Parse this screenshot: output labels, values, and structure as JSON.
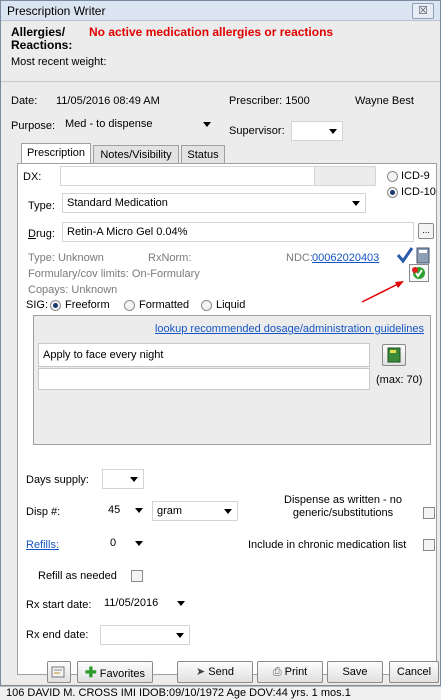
{
  "window": {
    "title": "Prescription Writer",
    "close_glyph": "☒"
  },
  "allergies": {
    "label_line1": "Allergies/",
    "label_line2": "Reactions:",
    "status": "No active medication allergies or reactions",
    "weight_label": "Most recent weight:"
  },
  "header": {
    "date_label": "Date:",
    "date_value": "11/05/2016 08:49 AM",
    "prescriber_label": "Prescriber: 1500",
    "prescriber_name": "Wayne Best",
    "purpose_label": "Purpose:",
    "purpose_value": "Med - to dispense",
    "supervisor_label": "Supervisor:",
    "supervisor_value": ""
  },
  "tabs": [
    {
      "label": "Prescription",
      "active": true
    },
    {
      "label": "Notes/Visibility",
      "active": false
    },
    {
      "label": "Status",
      "active": false
    }
  ],
  "prescription": {
    "dx_label": "DX:",
    "dx_value": "",
    "icd9_label": "ICD-9",
    "icd10_label": "ICD-10",
    "icd_selected": "ICD-10",
    "type_label": "Type:",
    "type_value": "Standard Medication",
    "drug_label": "Drug:",
    "drug_value": "Retin-A Micro Gel 0.04%",
    "drug_browse": "...",
    "type_info": "Type: Unknown",
    "rxnorm_label": "RxNorm:",
    "ndc_label": "NDC:",
    "ndc_value": "00062020403",
    "formulary": "Formulary/cov limits: On-Formulary",
    "copays": "Copays: Unknown",
    "sig_label": "SIG:",
    "sig_options": [
      "Freeform",
      "Formatted",
      "Liquid"
    ],
    "sig_selected": "Freeform",
    "lookup_link": "lookup recommended dosage/administration guidelines",
    "sig_text": "Apply to face every night",
    "sig_text2": "",
    "max_label": "(max: 70)",
    "days_supply_label": "Days supply:",
    "days_supply_value": "",
    "disp_label": "Disp #:",
    "disp_qty": "45",
    "disp_unit": "gram",
    "daw_label_line1": "Dispense as written - no",
    "daw_label_line2": "generic/substitutions",
    "refills_label": "Refills:",
    "refills_value": "0",
    "chronic_label": "Include in chronic medication list",
    "refill_as_needed_label": "Refill as needed",
    "rx_start_label": "Rx start date:",
    "rx_start_value": "11/05/2016",
    "rx_end_label": "Rx end date:",
    "rx_end_value": ""
  },
  "footer": {
    "favorites_label": "Favorites",
    "send_label": "Send",
    "print_label": "Print",
    "save_label": "Save",
    "cancel_label": "Cancel"
  },
  "statusbar": {
    "text": "106 DAVID M. CROSS IMI IDOB:09/10/1972 Age DOV:44 yrs. 1 mos.1"
  },
  "colors": {
    "alert_red": "#e00000",
    "link_blue": "#1655c4",
    "titlebar": "#dbe4f1"
  }
}
